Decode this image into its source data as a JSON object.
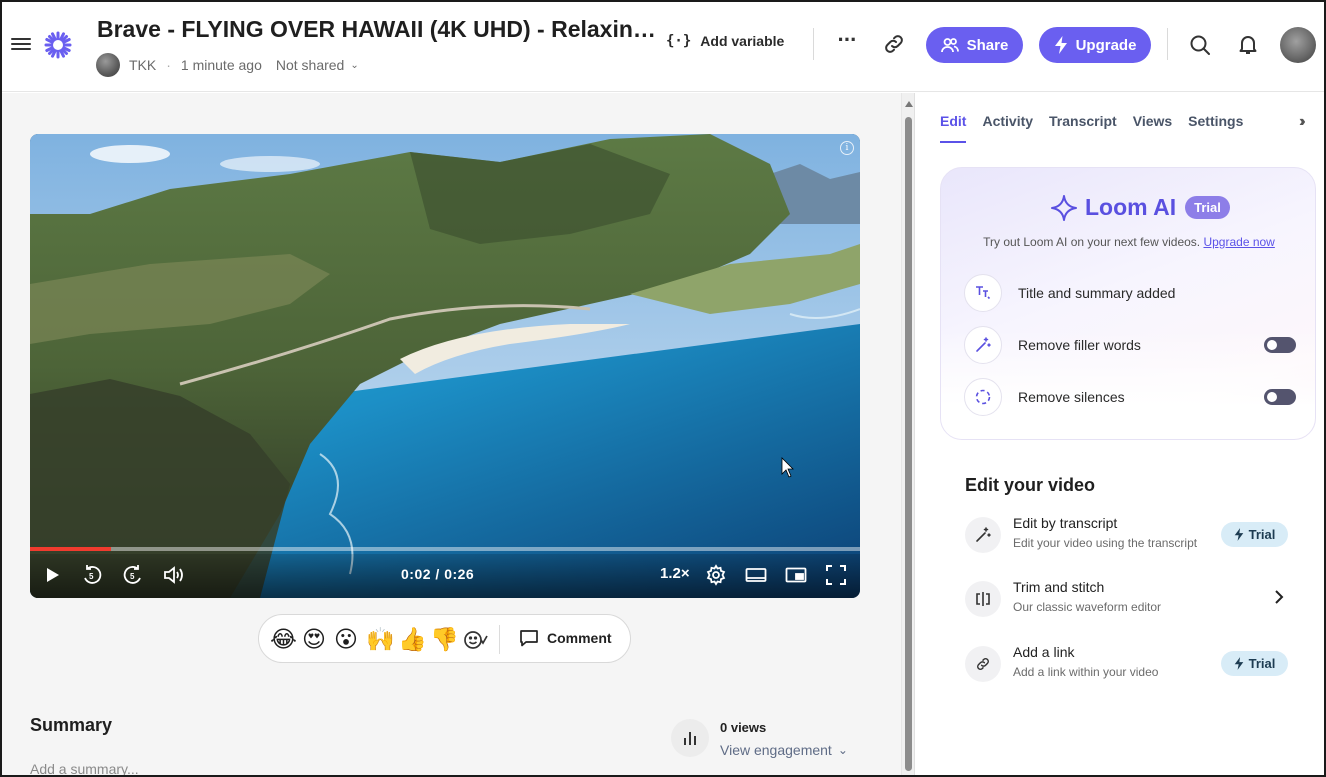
{
  "header": {
    "title": "Brave - FLYING OVER HAWAII (4K UHD) - Relaxing…",
    "owner": "TKK",
    "timestamp": "1 minute ago",
    "sharing_status": "Not shared",
    "add_variable_label": "Add variable",
    "share_label": "Share",
    "upgrade_label": "Upgrade",
    "accent_color": "#6a5ff0"
  },
  "player": {
    "time": "0:02 / 0:26",
    "speed": "1.2×",
    "progress": 0.097
  },
  "reactions": {
    "emojis": [
      "😂",
      "😍",
      "😮",
      "🙌",
      "👍",
      "👎"
    ],
    "comment_label": "Comment"
  },
  "summary": {
    "title": "Summary",
    "placeholder": "Add a summary..."
  },
  "stats": {
    "views": "0 views",
    "engagement_label": "View engagement"
  },
  "panel": {
    "tabs": [
      {
        "label": "Edit",
        "active": true
      },
      {
        "label": "Activity",
        "active": false
      },
      {
        "label": "Transcript",
        "active": false
      },
      {
        "label": "Views",
        "active": false
      },
      {
        "label": "Settings",
        "active": false
      }
    ],
    "loom_ai": {
      "name": "Loom AI",
      "badge": "Trial",
      "subtitle": "Try out Loom AI on your next few videos.",
      "upgrade_link": "Upgrade now",
      "features": [
        {
          "label": "Title and summary added",
          "icon": "text-sparkle-icon",
          "toggle": null
        },
        {
          "label": "Remove filler words",
          "icon": "magic-wand-icon",
          "toggle": false
        },
        {
          "label": "Remove silences",
          "icon": "dashed-circle-icon",
          "toggle": false
        }
      ]
    },
    "edit_video": {
      "title": "Edit your video",
      "items": [
        {
          "title": "Edit by transcript",
          "subtitle": "Edit your video using the transcript",
          "badge": "Trial",
          "icon": "magic-wand-icon"
        },
        {
          "title": "Trim and stitch",
          "subtitle": "Our classic waveform editor",
          "icon": "trim-icon"
        },
        {
          "title": "Add a link",
          "subtitle": "Add a link within your video",
          "badge": "Trial",
          "icon": "link-icon"
        }
      ]
    }
  }
}
